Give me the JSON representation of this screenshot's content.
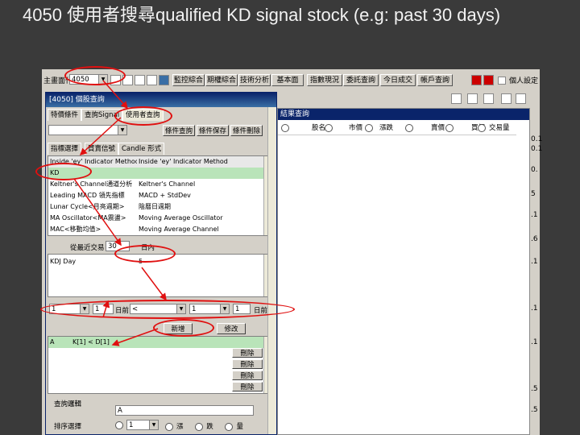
{
  "slide": {
    "title": "4050 使用者搜尋qualified KD signal stock (e.g: past 30 days)"
  },
  "toolbar": {
    "label": "主畫面代號",
    "code_value": "4050",
    "buttons": [
      "監控綜合",
      "期權綜合",
      "技術分析",
      "基本面",
      "指數現況",
      "委託查詢",
      "今日成交",
      "帳戶查詢"
    ],
    "checkbox_label": "個人設定"
  },
  "window": {
    "title": "[4050] 個股查詢",
    "tabs": [
      "特價條件",
      "查詢Signal",
      "使用者查詢"
    ],
    "subtabs": [
      "指標選擇",
      "買賣信號",
      "Candle 形式"
    ],
    "buttons": [
      "條件查詢",
      "條件保存",
      "條件刪除"
    ],
    "indicator_header": [
      "Inside 'ey' Indicator Method",
      "Inside 'ey' Indicator Method"
    ],
    "indicators": [
      {
        "left": "KD",
        "right": ""
      },
      {
        "left": "Keltner's Channel通道分析",
        "right": "Keltner's Channel"
      },
      {
        "left": "Leading MACD 領先指標",
        "right": "MACD + StdDev"
      },
      {
        "left": "Lunar Cycle<月亮週期>",
        "right": "陰曆日週期"
      },
      {
        "left": "MA Oscillator<MA震盪>",
        "right": "Moving Average Oscillator"
      },
      {
        "left": "MAC<移動均值>",
        "right": "Moving Average Channel"
      }
    ],
    "period_label": "從最近交易日",
    "period_value": "30",
    "period_unit": "日內",
    "param_row": {
      "name": "KDJ Day",
      "value": "5"
    },
    "condition": {
      "select1": "1",
      "select2": "1",
      "unit": "日前",
      "op": "<",
      "select3": "1",
      "select4": "1",
      "unit2": "日前"
    },
    "action_buttons": [
      "新增",
      "修改"
    ],
    "formula_header": {
      "col1": "A",
      "col2": "K[1] < D[1]"
    },
    "delete_label": "刪除",
    "logic_label": "查詢邏輯",
    "logic_value": "A",
    "select_label": "排序選擇",
    "select_value": "1",
    "radio_labels": [
      "漲",
      "跌",
      "量"
    ]
  },
  "result": {
    "title": "結果查詢",
    "columns": [
      "股名",
      "市價",
      "漲跌",
      "賣價",
      "買價",
      "交易量"
    ]
  },
  "edge_numbers": [
    "0.1",
    "0.1",
    "0.",
    "5",
    ".1",
    ".6",
    ".1",
    ".1",
    ".1",
    ".5",
    ".5"
  ]
}
